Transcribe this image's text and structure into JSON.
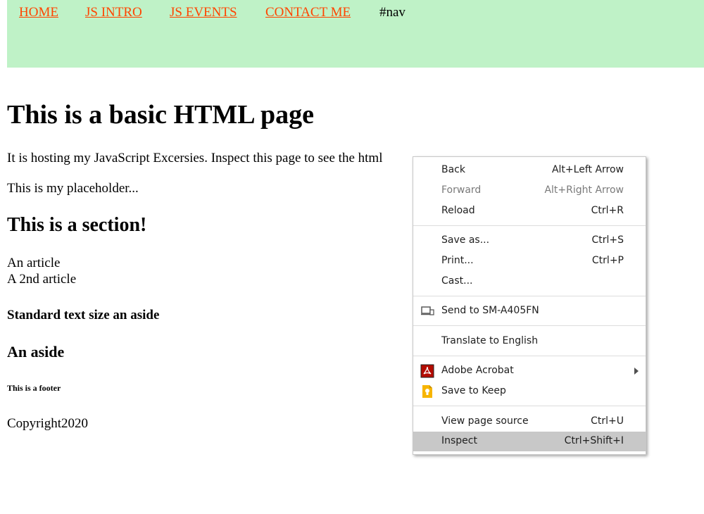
{
  "nav": {
    "links": [
      "HOME",
      "JS INTRO",
      "JS EVENTS",
      "CONTACT ME"
    ],
    "tag": "#nav"
  },
  "page": {
    "heading": "This is a basic HTML page",
    "intro": "It is hosting my JavaScript Excersies. Inspect this page to see the html",
    "placeholder": "This is my placeholder...",
    "section_heading": "This is a section!",
    "article1": "An article",
    "article2": "A 2nd article",
    "aside_text": "Standard text size an aside",
    "aside_heading": "An aside",
    "footer": "This is a footer",
    "copyright": "Copyright2020"
  },
  "context_menu": {
    "items": [
      {
        "label": "Back",
        "shortcut": "Alt+Left Arrow"
      },
      {
        "label": "Forward",
        "shortcut": "Alt+Right Arrow",
        "disabled": true
      },
      {
        "label": "Reload",
        "shortcut": "Ctrl+R"
      },
      {
        "label": "Save as...",
        "shortcut": "Ctrl+S"
      },
      {
        "label": "Print...",
        "shortcut": "Ctrl+P"
      },
      {
        "label": "Cast...",
        "shortcut": ""
      },
      {
        "label": "Send to SM-A405FN",
        "shortcut": "",
        "icon": "devices-icon"
      },
      {
        "label": "Translate to English",
        "shortcut": ""
      },
      {
        "label": "Adobe Acrobat",
        "shortcut": "",
        "icon": "adobe-acrobat-icon",
        "submenu": true
      },
      {
        "label": "Save to Keep",
        "shortcut": "",
        "icon": "google-keep-icon"
      },
      {
        "label": "View page source",
        "shortcut": "Ctrl+U"
      },
      {
        "label": "Inspect",
        "shortcut": "Ctrl+Shift+I",
        "highlighted": true
      }
    ]
  },
  "colors": {
    "nav_bg": "#bff2c7",
    "link": "#ff4500",
    "menu_highlight": "#c8c8c8",
    "acrobat_red": "#b30b00",
    "keep_yellow": "#f7b500"
  }
}
